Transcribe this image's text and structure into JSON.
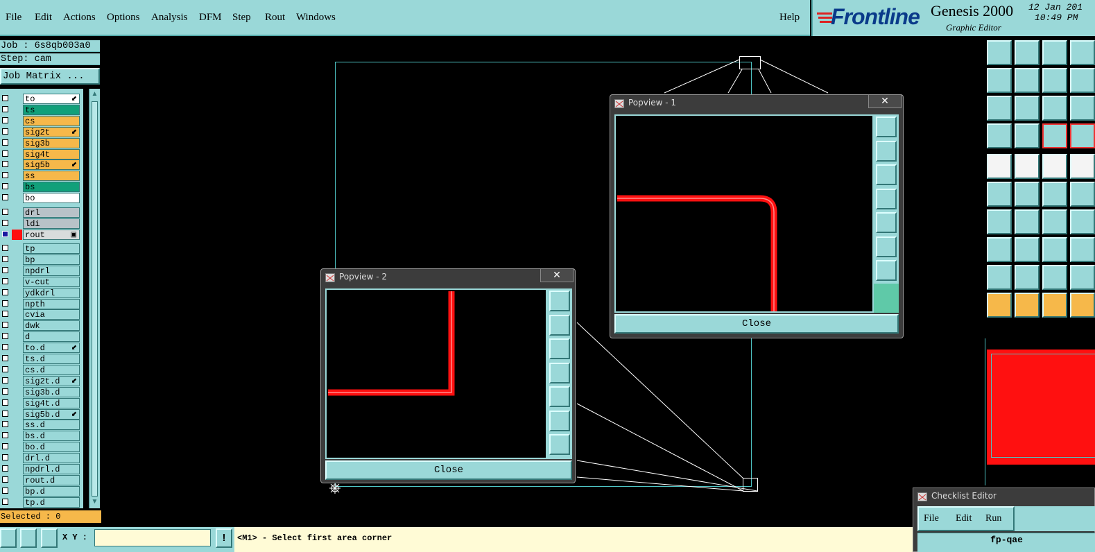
{
  "menubar": {
    "items": [
      "File",
      "Edit",
      "Actions",
      "Options",
      "Analysis",
      "DFM",
      "Step",
      "Rout",
      "Windows"
    ],
    "help": "Help"
  },
  "brand": {
    "logo": "Frontline",
    "product": "Genesis 2000",
    "subtitle": "Graphic Editor",
    "date": "12 Jan 201",
    "time": "10:49 PM"
  },
  "job": {
    "job_line": "Job : 6s8qb003a0",
    "step_line": "Step: cam",
    "matrix_button": "Job Matrix ..."
  },
  "layers_board": [
    {
      "name": "to",
      "color": "#ffffff",
      "mark": "⬋"
    },
    {
      "name": "ts",
      "color": "#11a07a",
      "mark": ""
    },
    {
      "name": "cs",
      "color": "#f6b84a",
      "mark": ""
    },
    {
      "name": "sig2t",
      "color": "#f6b84a",
      "mark": "⬋"
    },
    {
      "name": "sig3b",
      "color": "#f6b84a",
      "mark": ""
    },
    {
      "name": "sig4t",
      "color": "#f6b84a",
      "mark": ""
    },
    {
      "name": "sig5b",
      "color": "#f6b84a",
      "mark": "⬋"
    },
    {
      "name": "ss",
      "color": "#f6b84a",
      "mark": ""
    },
    {
      "name": "bs",
      "color": "#11a07a",
      "mark": ""
    },
    {
      "name": "bo",
      "color": "#ffffff",
      "mark": ""
    }
  ],
  "layers_drill": [
    {
      "name": "drl",
      "color": "#b8c2c8",
      "mark": ""
    },
    {
      "name": "ldi",
      "color": "#b8c2c8",
      "mark": ""
    },
    {
      "name": "rout",
      "color": "#d8dcdc",
      "mark": "▣"
    }
  ],
  "layers_misc": [
    {
      "name": "tp",
      "mark": ""
    },
    {
      "name": "bp",
      "mark": ""
    },
    {
      "name": "npdrl",
      "mark": ""
    },
    {
      "name": "v-cut",
      "mark": ""
    },
    {
      "name": "ydkdrl",
      "mark": ""
    },
    {
      "name": "npth",
      "mark": ""
    },
    {
      "name": "cvia",
      "mark": ""
    },
    {
      "name": "dwk",
      "mark": ""
    },
    {
      "name": "d",
      "mark": ""
    },
    {
      "name": "to.d",
      "mark": "⬋"
    },
    {
      "name": "ts.d",
      "mark": ""
    },
    {
      "name": "cs.d",
      "mark": ""
    },
    {
      "name": "sig2t.d",
      "mark": "⬋"
    },
    {
      "name": "sig3b.d",
      "mark": ""
    },
    {
      "name": "sig4t.d",
      "mark": ""
    },
    {
      "name": "sig5b.d",
      "mark": "⬋"
    },
    {
      "name": "ss.d",
      "mark": ""
    },
    {
      "name": "bs.d",
      "mark": ""
    },
    {
      "name": "bo.d",
      "mark": ""
    },
    {
      "name": "drl.d",
      "mark": ""
    },
    {
      "name": "npdrl.d",
      "mark": ""
    },
    {
      "name": "rout.d",
      "mark": ""
    },
    {
      "name": "bp.d",
      "mark": ""
    },
    {
      "name": "tp.d",
      "mark": ""
    }
  ],
  "selected": "Selected : 0",
  "popview1": {
    "title": "Popview - 1",
    "close_x": "✕",
    "close_label": "Close"
  },
  "popview2": {
    "title": "Popview - 2",
    "close_x": "✕",
    "close_label": "Close"
  },
  "status": {
    "xy_label": "X Y :",
    "xy_value": "",
    "info_icon": "!",
    "prompt": "<M1> - Select first area corner"
  },
  "checklist": {
    "title": "Checklist Editor",
    "menu": [
      "File",
      "Edit",
      "Run"
    ],
    "name": "fp-qae"
  },
  "colors": {
    "panel": "#9ad8d8",
    "trace": "#ff2020",
    "accent_orange": "#f6b84a",
    "accent_green": "#11a07a"
  }
}
